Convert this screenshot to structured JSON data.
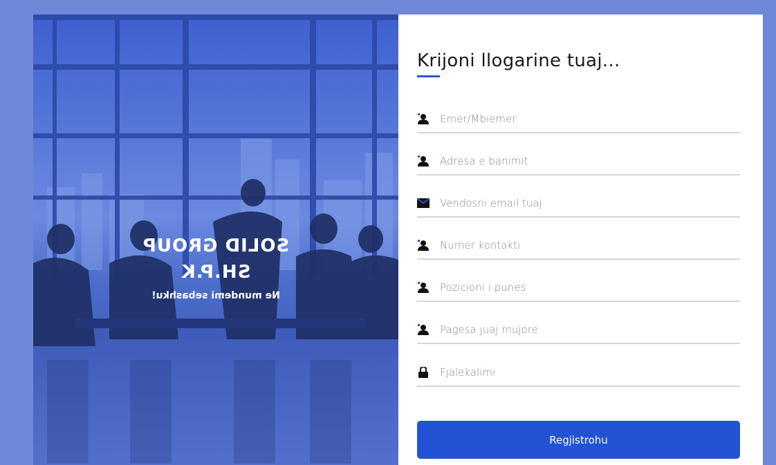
{
  "hero": {
    "title": "SOLID GROUP",
    "subtitle": "SH.P.K",
    "tagline": "Ne mundemi sebashku!"
  },
  "form": {
    "title": "Krijoni llogarine tuaj...",
    "fields": [
      {
        "icon": "user-icon",
        "placeholder": "Emer/Mbiemer",
        "value": ""
      },
      {
        "icon": "user-icon",
        "placeholder": "Adresa e banimit",
        "value": ""
      },
      {
        "icon": "envelope-icon",
        "placeholder": "Vendosni email tuaj",
        "value": ""
      },
      {
        "icon": "user-icon",
        "placeholder": "Numer kontakti",
        "value": ""
      },
      {
        "icon": "user-icon",
        "placeholder": "Pozicioni i punes",
        "value": ""
      },
      {
        "icon": "user-icon",
        "placeholder": "Pagesa juaj mujore",
        "value": ""
      },
      {
        "icon": "lock-icon",
        "placeholder": "Fjalekalimi",
        "value": ""
      }
    ],
    "submit_label": "Regjistrohu"
  },
  "colors": {
    "page_background": "#7088d8",
    "accent": "#2352d4",
    "field_underline": "#d5d5d5"
  }
}
